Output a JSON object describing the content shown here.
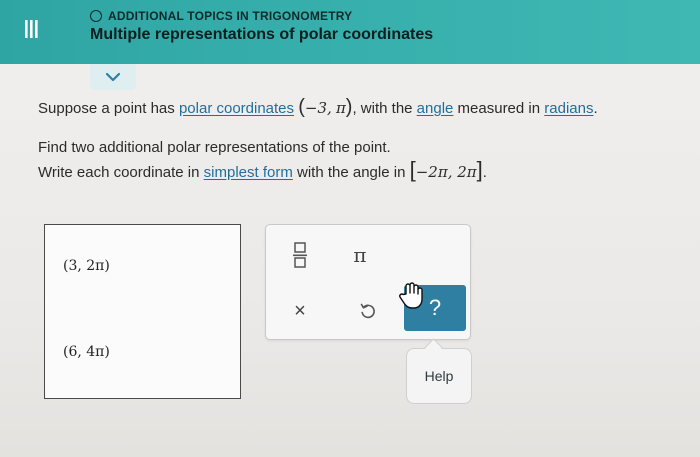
{
  "header": {
    "topic": "ADDITIONAL TOPICS IN TRIGONOMETRY",
    "title": "Multiple representations of polar coordinates"
  },
  "question": {
    "line1_prefix": "Suppose a point has ",
    "polar_coordinates_link": "polar coordinates",
    "point_r": "−3,",
    "point_theta": "π",
    "line1_middle": ", with the ",
    "angle_link": "angle",
    "line1_middle2": " measured in ",
    "radians_link": "radians",
    "line1_end": ".",
    "line2": "Find two additional polar representations of the point.",
    "line3_prefix": "Write each coordinate in ",
    "simplest_form_link": "simplest form",
    "line3_middle": " with the angle in ",
    "interval": "−2π,  2π",
    "line3_end": "."
  },
  "answers": [
    "(3, 2π)",
    "(6, 4π)"
  ],
  "toolbox": {
    "pi_symbol": "π",
    "clear_symbol": "×",
    "help_symbol": "?",
    "help_tooltip": "Help"
  },
  "colors": {
    "header": "#37b0ad",
    "link": "#1f6f9c",
    "help_button": "#2f7fa3"
  }
}
